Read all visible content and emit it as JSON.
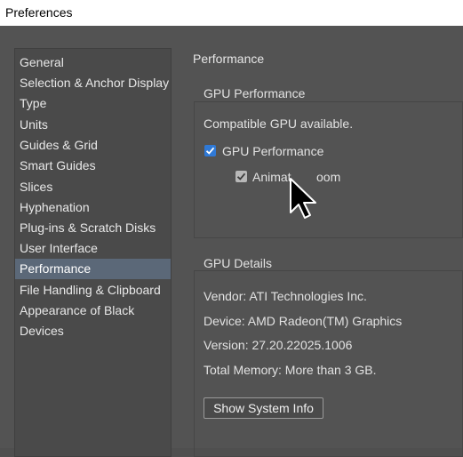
{
  "window": {
    "title": "Preferences"
  },
  "sidebar": {
    "items": [
      {
        "label": "General"
      },
      {
        "label": "Selection & Anchor Display"
      },
      {
        "label": "Type"
      },
      {
        "label": "Units"
      },
      {
        "label": "Guides & Grid"
      },
      {
        "label": "Smart Guides"
      },
      {
        "label": "Slices"
      },
      {
        "label": "Hyphenation"
      },
      {
        "label": "Plug-ins & Scratch Disks"
      },
      {
        "label": "User Interface"
      },
      {
        "label": "Performance",
        "selected": true
      },
      {
        "label": "File Handling & Clipboard"
      },
      {
        "label": "Appearance of Black"
      },
      {
        "label": "Devices"
      }
    ]
  },
  "main": {
    "section_title": "Performance",
    "gpu_performance": {
      "title": "GPU Performance",
      "status": "Compatible GPU available.",
      "gpu_checkbox": {
        "label": "GPU Performance",
        "checked": true
      },
      "animated_zoom_checkbox": {
        "label": "Animated Zoom",
        "checked": true,
        "visible_text": "Animat",
        "visible_text_tail": "oom"
      }
    },
    "gpu_details": {
      "title": "GPU Details",
      "vendor": "Vendor: ATI Technologies Inc.",
      "device": "Device: AMD Radeon(TM) Graphics",
      "version": "Version: 27.20.22025.1006",
      "memory": "Total Memory:  More than 3 GB.",
      "show_system_info": "Show System Info"
    }
  },
  "colors": {
    "accent": "#2f79d6",
    "selected_row": "#5b6878",
    "panel_bg": "#535353"
  },
  "icons": [
    "checkmark-icon",
    "mouse-pointer-icon"
  ]
}
